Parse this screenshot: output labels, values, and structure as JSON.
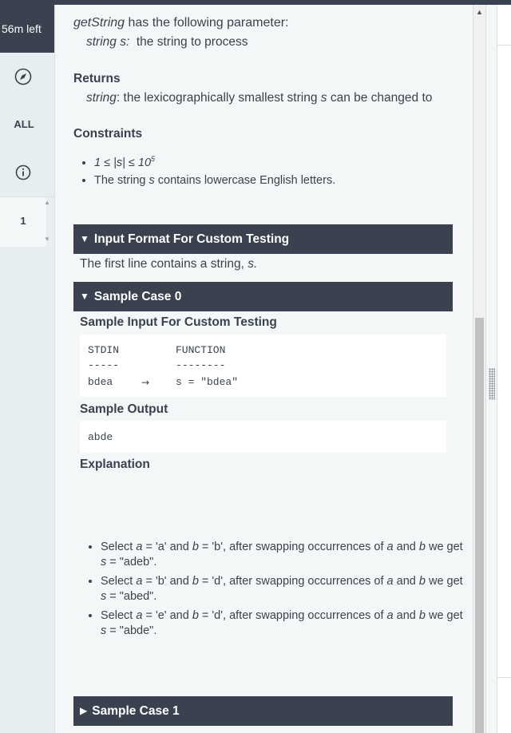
{
  "rail": {
    "timer": "56m left",
    "nav_icon": "compass-icon",
    "all_label": "ALL",
    "info_icon": "info-icon",
    "question_number": "1"
  },
  "problem": {
    "param_intro_fn": "getString",
    "param_intro_rest": " has the following parameter:",
    "param_name": "string s:",
    "param_desc": "  the string to process",
    "returns_heading": "Returns",
    "returns_type": "string",
    "returns_desc_a": ": the lexicographically smallest string ",
    "returns_var": "s",
    "returns_desc_b": " can be changed to",
    "constraints_heading": "Constraints",
    "constraint1_a": "1 ≤ |s| ≤ 10",
    "constraint1_exp": "5",
    "constraint2_a": "The string ",
    "constraint2_var": "s",
    "constraint2_b": " contains lowercase English letters."
  },
  "input_format": {
    "bar_label": "Input Format For Custom Testing",
    "text_a": "The first line contains a string, ",
    "text_var": "s.",
    "expanded_icon": "triangle-down-icon"
  },
  "sample0": {
    "bar_label": "Sample Case 0",
    "input_heading": "Sample Input For Custom Testing",
    "col1_header": "STDIN",
    "col2_header": "FUNCTION",
    "col1_rule": "-----",
    "col2_rule": "--------",
    "stdin_value": "bdea",
    "arrow": "→",
    "function_value": "s = \"bdea\"",
    "output_heading": "Sample Output",
    "output_value": "abde",
    "explanation_heading": "Explanation",
    "steps": [
      {
        "a": "Select ",
        "v1": "a",
        "b": " = 'a' and ",
        "v2": "b",
        "c": " = 'b', after swapping occurrences of ",
        "v3": "a",
        "d": " and ",
        "v4": "b",
        "e": " we get ",
        "v5": "s",
        "f": " = \"adeb\"."
      },
      {
        "a": "Select ",
        "v1": "a",
        "b": " = 'b' and ",
        "v2": "b",
        "c": " = 'd', after swapping occurrences of ",
        "v3": "a",
        "d": " and ",
        "v4": "b",
        "e": " we get ",
        "v5": "s",
        "f": " = \"abed\"."
      },
      {
        "a": "Select ",
        "v1": "a",
        "b": " = 'e' and ",
        "v2": "b",
        "c": " = 'd', after swapping occurrences of ",
        "v3": "a",
        "d": " and ",
        "v4": "b",
        "e": " we get ",
        "v5": "s",
        "f": " = \"abde\"."
      }
    ]
  },
  "sample1": {
    "bar_label": "Sample Case 1",
    "collapsed_icon": "triangle-right-icon"
  },
  "colors": {
    "bar_bg": "#39424e",
    "text": "#39424e",
    "panel_bg": "#f3f7f7",
    "code_bg": "#ffffff"
  }
}
